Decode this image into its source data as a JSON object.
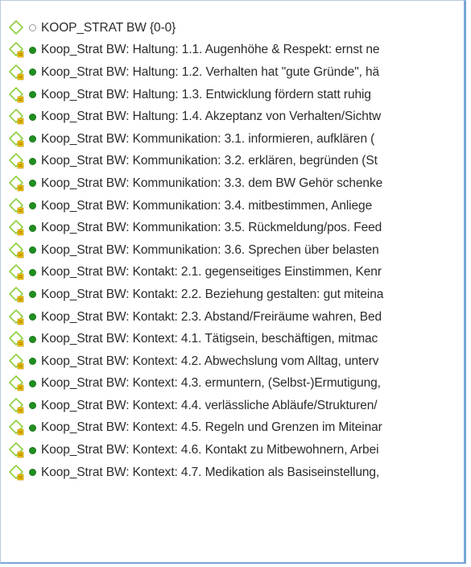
{
  "code_list": {
    "items": [
      {
        "label": "KOOP_STRAT BW {0-0}",
        "status": "hollow",
        "icon": "code-diamond-icon"
      },
      {
        "label": "Koop_Strat BW: Haltung: 1.1. Augenhöhe & Respekt: ernst ne",
        "status": "filled",
        "icon": "code-diamond-memo-icon"
      },
      {
        "label": "Koop_Strat BW: Haltung: 1.2. Verhalten hat \"gute Gründe\", hä",
        "status": "filled",
        "icon": "code-diamond-memo-icon"
      },
      {
        "label": "Koop_Strat BW: Haltung: 1.3. Entwicklung fördern statt ruhig",
        "status": "filled",
        "icon": "code-diamond-memo-icon"
      },
      {
        "label": "Koop_Strat BW: Haltung: 1.4. Akzeptanz von Verhalten/Sichtw",
        "status": "filled",
        "icon": "code-diamond-memo-icon"
      },
      {
        "label": "Koop_Strat BW: Kommunikation: 3.1. informieren, aufklären (",
        "status": "filled",
        "icon": "code-diamond-memo-icon"
      },
      {
        "label": "Koop_Strat BW: Kommunikation: 3.2. erklären, begründen (St",
        "status": "filled",
        "icon": "code-diamond-memo-icon"
      },
      {
        "label": "Koop_Strat BW: Kommunikation: 3.3. dem BW Gehör schenke",
        "status": "filled",
        "icon": "code-diamond-memo-icon"
      },
      {
        "label": "Koop_Strat BW: Kommunikation: 3.4. mitbestimmen, Anliege",
        "status": "filled",
        "icon": "code-diamond-memo-icon"
      },
      {
        "label": "Koop_Strat BW: Kommunikation: 3.5. Rückmeldung/pos. Feed",
        "status": "filled",
        "icon": "code-diamond-memo-icon"
      },
      {
        "label": "Koop_Strat BW: Kommunikation: 3.6. Sprechen über belasten",
        "status": "filled",
        "icon": "code-diamond-memo-icon"
      },
      {
        "label": "Koop_Strat BW: Kontakt: 2.1. gegenseitiges Einstimmen, Kenr",
        "status": "filled",
        "icon": "code-diamond-memo-icon"
      },
      {
        "label": "Koop_Strat BW: Kontakt: 2.2. Beziehung gestalten: gut miteina",
        "status": "filled",
        "icon": "code-diamond-memo-icon"
      },
      {
        "label": "Koop_Strat BW: Kontakt: 2.3. Abstand/Freiräume wahren, Bed",
        "status": "filled",
        "icon": "code-diamond-memo-icon"
      },
      {
        "label": "Koop_Strat BW: Kontext: 4.1. Tätigsein, beschäftigen, mitmac",
        "status": "filled",
        "icon": "code-diamond-memo-icon"
      },
      {
        "label": "Koop_Strat BW: Kontext: 4.2. Abwechslung vom Alltag, unterv",
        "status": "filled",
        "icon": "code-diamond-memo-icon"
      },
      {
        "label": "Koop_Strat BW: Kontext: 4.3. ermuntern, (Selbst-)Ermutigung,",
        "status": "filled",
        "icon": "code-diamond-memo-icon"
      },
      {
        "label": "Koop_Strat BW: Kontext: 4.4. verlässliche Abläufe/Strukturen/",
        "status": "filled",
        "icon": "code-diamond-memo-icon"
      },
      {
        "label": "Koop_Strat BW: Kontext: 4.5. Regeln und Grenzen im Miteinar",
        "status": "filled",
        "icon": "code-diamond-memo-icon"
      },
      {
        "label": "Koop_Strat BW: Kontext: 4.6. Kontakt zu Mitbewohnern, Arbei",
        "status": "filled",
        "icon": "code-diamond-memo-icon"
      },
      {
        "label": "Koop_Strat BW: Kontext: 4.7. Medikation als Basiseinstellung,",
        "status": "filled",
        "icon": "code-diamond-memo-icon"
      }
    ]
  },
  "colors": {
    "diamond": "#8fcf3f",
    "memo": "#f2c200",
    "status_filled": "#1f8f1f",
    "status_hollow": "#9a9a9a",
    "panel_border": "#7aa6d6"
  }
}
